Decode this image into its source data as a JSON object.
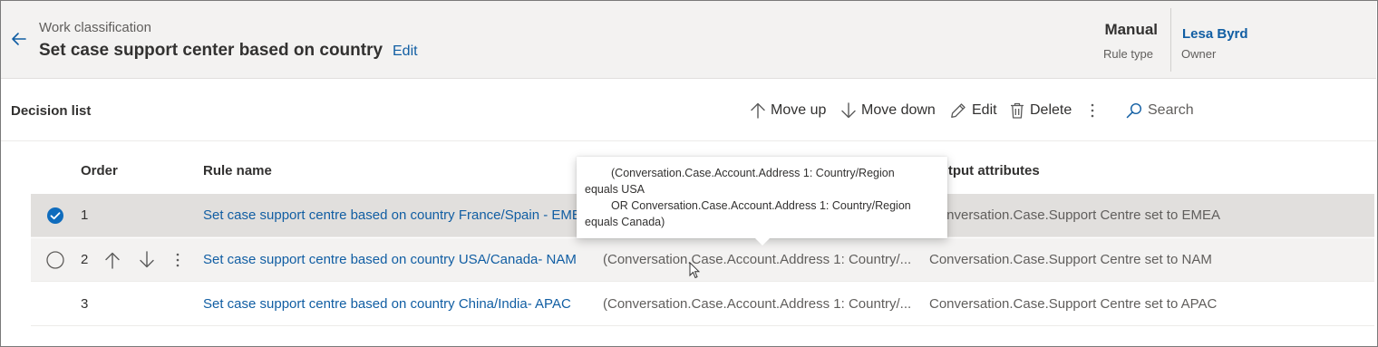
{
  "header": {
    "subtitle": "Work classification",
    "title": "Set case support center based on country",
    "edit_label": "Edit",
    "rule_type_value": "Manual",
    "rule_type_label": "Rule type",
    "owner_value": "Lesa Byrd",
    "owner_label": "Owner"
  },
  "toolbar": {
    "title": "Decision list",
    "move_up": "Move up",
    "move_down": "Move down",
    "edit": "Edit",
    "delete": "Delete",
    "search": "Search"
  },
  "table": {
    "columns": {
      "order": "Order",
      "rule_name": "Rule name",
      "output": "Output attributes"
    },
    "rows": [
      {
        "order": "1",
        "name": "Set case support centre based on country France/Spain - EMEA",
        "condition": "",
        "output": "Conversation.Case.Support Centre set to EMEA",
        "selected": true
      },
      {
        "order": "2",
        "name": "Set case support centre based on country USA/Canada- NAM",
        "condition": "(Conversation.Case.Account.Address 1: Country/...",
        "output": "Conversation.Case.Support Centre set to NAM",
        "selected": false
      },
      {
        "order": "3",
        "name": "Set case support centre based on country China/India- APAC",
        "condition": "(Conversation.Case.Account.Address 1: Country/...",
        "output": "Conversation.Case.Support Centre set to APAC",
        "selected": false
      }
    ]
  },
  "tooltip": {
    "line1": "(Conversation.Case.Account.Address 1: Country/Region",
    "line2": "equals USA",
    "line3": "OR Conversation.Case.Account.Address 1: Country/Region",
    "line4": "equals Canada)"
  },
  "icons": {
    "back": "arrow-left-icon",
    "move_up": "arrow-up-icon",
    "move_down": "arrow-down-icon",
    "edit": "pencil-icon",
    "delete": "trash-icon",
    "more": "more-vertical-icon",
    "search": "search-icon",
    "checked": "checkmark-circle-icon",
    "unchecked": "circle-icon"
  },
  "colors": {
    "accent": "#115ea3",
    "check_fill": "#0f6cbd",
    "header_bg": "#f3f2f1",
    "selected_row": "#e1dfdd"
  }
}
